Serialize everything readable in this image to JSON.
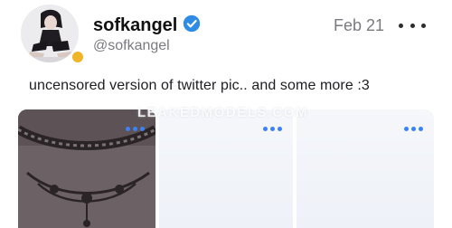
{
  "post": {
    "author": {
      "display_name": "sofkangel",
      "handle": "@sofkangel",
      "verified": true,
      "status_color": "#f0b429",
      "verified_color": "#2e8be6"
    },
    "date": "Feb 21",
    "more_icon": "more-horizontal-icon",
    "text": "uncensored version of twitter pic.. and some more :3",
    "media": [
      {
        "type": "image",
        "state": "visible",
        "menu_icon": "more-dots-icon"
      },
      {
        "type": "image",
        "state": "locked",
        "menu_icon": "more-dots-icon"
      },
      {
        "type": "image",
        "state": "locked",
        "menu_icon": "more-dots-icon"
      }
    ],
    "watermark": "LEAKEDMODELS.COM"
  },
  "colors": {
    "accent": "#3b82f6",
    "muted_text": "#7a7a80"
  }
}
